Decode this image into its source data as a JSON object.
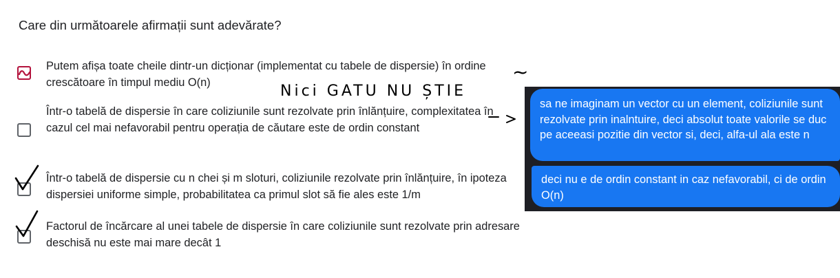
{
  "question": {
    "text": "Care din următoarele afirmații sunt adevărate?"
  },
  "options": [
    {
      "text": "Putem afișa toate cheile dintr-un dicționar (implementat cu tabele de dispersie) în ordine crescătoare în timpul mediu O(n)",
      "checkbox_state": "scribbled-red"
    },
    {
      "text": "Într-o tabelă de dispersie în care coliziunile sunt rezolvate prin înlănțuire, complexitatea în cazul cel mai nefavorabil pentru operația de căutare este de ordin constant",
      "checkbox_state": "unchecked"
    },
    {
      "text": "Într-o tabelă de dispersie cu n chei și m sloturi, coliziunile rezolvate prin înlănțuire, în ipoteza dispersiei uniforme simple, probabilitatea ca primul slot să fie ales este 1/m",
      "checkbox_state": "hand-checked"
    },
    {
      "text": "Factorul de încărcare al unei tabele de dispersie în care coliziunile sunt rezolvate prin adresare deschisă nu este mai mare decât 1",
      "checkbox_state": "hand-checked"
    }
  ],
  "annotation": {
    "handwritten_text": "Nici GATU NU ȘTIE",
    "arrow": "->",
    "tilde": "~"
  },
  "chat": {
    "messages": [
      "sa ne imaginam un vector cu un element, coliziunile sunt rezolvate prin inalntuire, deci absolut toate valorile se duc pe aceeasi pozitie din vector si, deci, alfa-ul ala este n",
      "deci nu e de ordin constant in caz nefavorabil, ci de ordin O(n)"
    ]
  },
  "colors": {
    "accent_red": "#b3123c",
    "bubble_blue": "#1877f2",
    "chat_background": "#1e1f25",
    "ink": "#000000"
  }
}
